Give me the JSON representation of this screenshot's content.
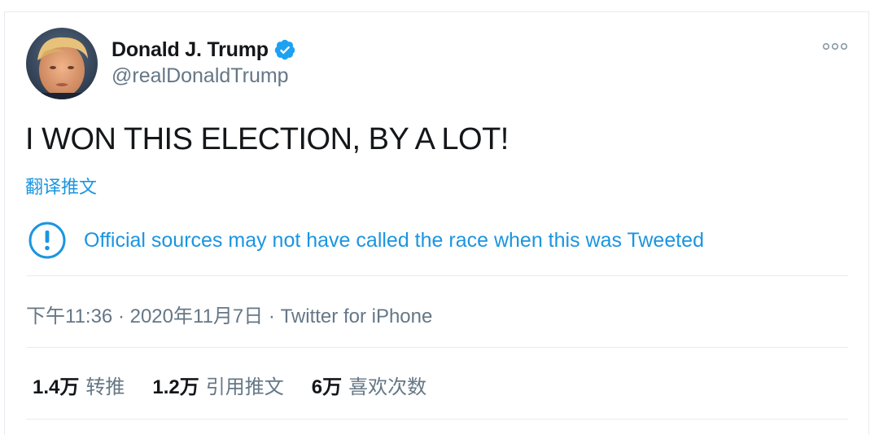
{
  "author": {
    "display_name": "Donald J. Trump",
    "handle": "@realDonaldTrump",
    "verified": true,
    "avatar_icon": "profile-photo"
  },
  "tweet": {
    "text": "I WON THIS ELECTION, BY A LOT!",
    "translate_label": "翻译推文"
  },
  "notice": {
    "icon": "exclamation-circle-icon",
    "text": "Official sources may not have called the race when this was Tweeted"
  },
  "meta": {
    "time": "下午11:36",
    "separator": " · ",
    "date": "2020年11月7日",
    "source": "Twitter for iPhone"
  },
  "stats": [
    {
      "count": "1.4万",
      "label": "转推"
    },
    {
      "count": "1.2万",
      "label": "引用推文"
    },
    {
      "count": "6万",
      "label": "喜欢次数"
    }
  ],
  "colors": {
    "link_blue": "#1b95e0",
    "verified_blue": "#1da1f2",
    "text_primary": "#14171a",
    "text_secondary": "#657786",
    "divider": "#e6ecf0"
  }
}
